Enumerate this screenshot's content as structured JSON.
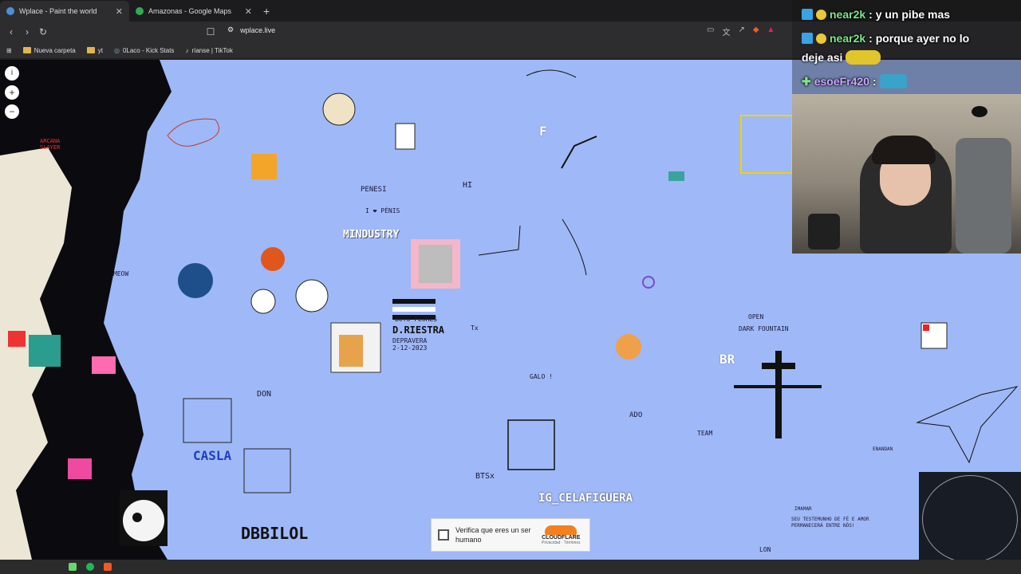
{
  "browser": {
    "tabs": [
      {
        "title": "Wplace - Paint the world",
        "active": true,
        "favicon_color": "#4a90d9"
      },
      {
        "title": "Amazonas - Google Maps",
        "active": false,
        "favicon_color": "#34a853"
      }
    ],
    "url": "wplace.live",
    "bookmarks": [
      "Nueva carpeta",
      "yt",
      "0Laco - Kick Stats",
      "ríanse | TikTok"
    ]
  },
  "chat": {
    "messages": [
      {
        "user": "near2k",
        "text": ": y un pibe mas"
      },
      {
        "user": "near2k",
        "text": ": porque ayer no lo"
      },
      {
        "user": "",
        "text": "deje asi"
      },
      {
        "user": "esoeFr420",
        "text": ":"
      }
    ]
  },
  "canvas": {
    "background": "#9fb8f7",
    "labels": [
      "PENESI",
      "MINDUSTRY",
      "I ❤ PÉNIS",
      "HI",
      "F",
      "BOTO FLORES",
      "D.RIESTRA",
      "DEPRAVERA",
      "2-12-2023",
      "GALO !",
      "ADO",
      "TEAM",
      "BTSx",
      "IG_CELAFIGUERA",
      "CASLA",
      "DBBILOL",
      "BR",
      "OPEN",
      "DARK FOUNTAIN",
      "MEOW",
      "DON",
      "LON",
      "SEU TESTEMUNHO DE FÉ E AMOR",
      "PERMANECERÁ ENTRE NÓS!",
      "ARCANA",
      "SLAYER",
      "Tx",
      "IMAMAR",
      "ENANDAN"
    ]
  },
  "cloudflare": {
    "label": "Verifica que eres un ser humano",
    "brand": "CLOUDFLARE",
    "links": "Privacidad · Términos"
  }
}
